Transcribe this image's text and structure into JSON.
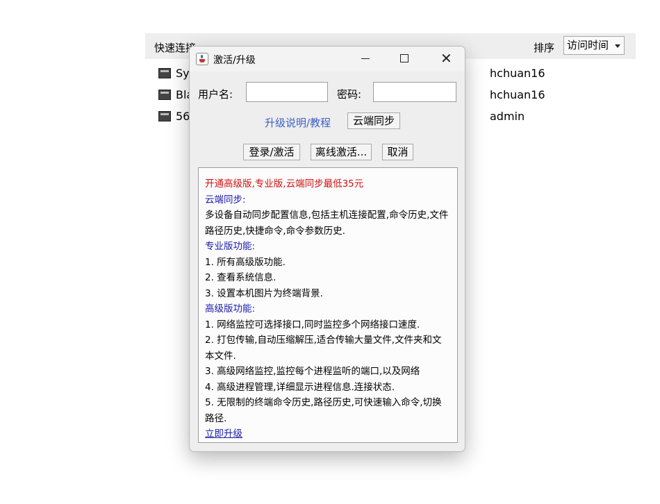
{
  "background": {
    "title": "快速连接",
    "sort_label": "排序",
    "sort_value": "访问时间",
    "rows": [
      {
        "name": "Sy",
        "user": "hchuan16"
      },
      {
        "name": "Bla",
        "user": "hchuan16"
      },
      {
        "name": "56",
        "user": "admin"
      }
    ]
  },
  "dialog": {
    "title": "激活/升级",
    "username_label": "用户名:",
    "username_value": "",
    "password_label": "密码:",
    "password_value": "",
    "upgrade_help_link": "升级说明/教程",
    "cloud_sync_button": "云端同步",
    "login_button": "登录/激活",
    "offline_button": "离线激活...",
    "cancel_button": "取消",
    "info": {
      "promo": "开通高级版,专业版,云端同步最低35元",
      "cloud_heading": "云端同步:",
      "cloud_desc": "多设备自动同步配置信息,包括主机连接配置,命令历史,文件路径历史,快捷命令,命令参数历史.",
      "pro_heading": "专业版功能:",
      "pro_items": [
        "1. 所有高级版功能.",
        "2. 查看系统信息.",
        "3. 设置本机图片为终端背景."
      ],
      "adv_heading": "高级版功能:",
      "adv_items": [
        "1. 网络监控可选择接口,同时监控多个网络接口速度.",
        "2. 打包传输,自动压缩解压,适合传输大量文件,文件夹和文本文件.",
        "3. 高级网络监控,监控每个进程监听的端口,以及网络",
        "4. 高级进程管理,详细显示进程信息.连接状态.",
        "5. 无限制的终端命令历史,路径历史,可快速输入命令,切换路径."
      ],
      "upgrade_now": "立即升级"
    }
  },
  "colors": {
    "promo": "#d01010",
    "heading": "#1a1aaa",
    "link": "#3c5fc7"
  }
}
